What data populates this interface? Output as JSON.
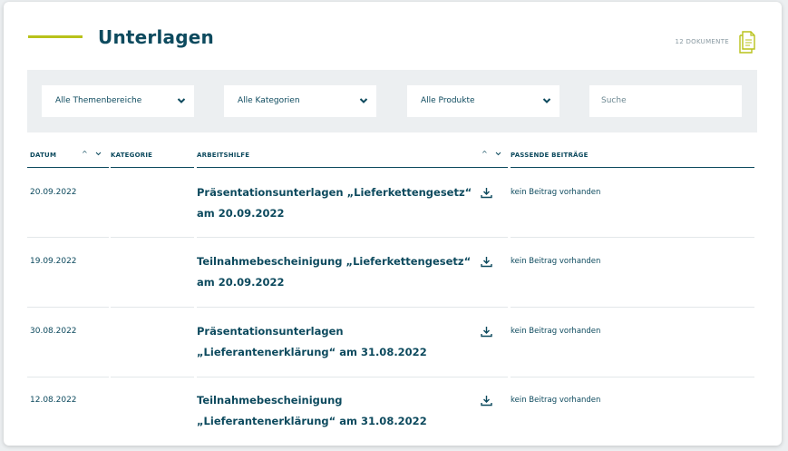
{
  "header": {
    "title": "Unterlagen",
    "doc_count": "12 DOKUMENTE",
    "accent_color": "#b8c21a",
    "text_color": "#0d4a5e"
  },
  "filters": {
    "themes": "Alle Themenbereiche",
    "categories": "Alle Kategorien",
    "products": "Alle Produkte",
    "search_placeholder": "Suche"
  },
  "table": {
    "columns": {
      "date": "DATUM",
      "category": "KATEGORIE",
      "tool": "ARBEITSHILFE",
      "posts": "PASSENDE BEITRÄGE"
    },
    "rows": [
      {
        "date": "20.09.2022",
        "category": "",
        "title": "Präsentationsunterlagen „Lieferkettengesetz“ am 20.09.2022",
        "posts": "kein Beitrag vorhanden"
      },
      {
        "date": "19.09.2022",
        "category": "",
        "title": "Teilnahmebescheinigung „Lieferkettengesetz“ am 20.09.2022",
        "posts": "kein Beitrag vorhanden"
      },
      {
        "date": "30.08.2022",
        "category": "",
        "title": "Präsentationsunterlagen „Lieferantenerklärung“ am 31.08.2022",
        "posts": "kein Beitrag vorhanden"
      },
      {
        "date": "12.08.2022",
        "category": "",
        "title": "Teilnahmebescheinigung „Lieferantenerklärung“ am 31.08.2022",
        "posts": "kein Beitrag vorhanden"
      }
    ]
  }
}
